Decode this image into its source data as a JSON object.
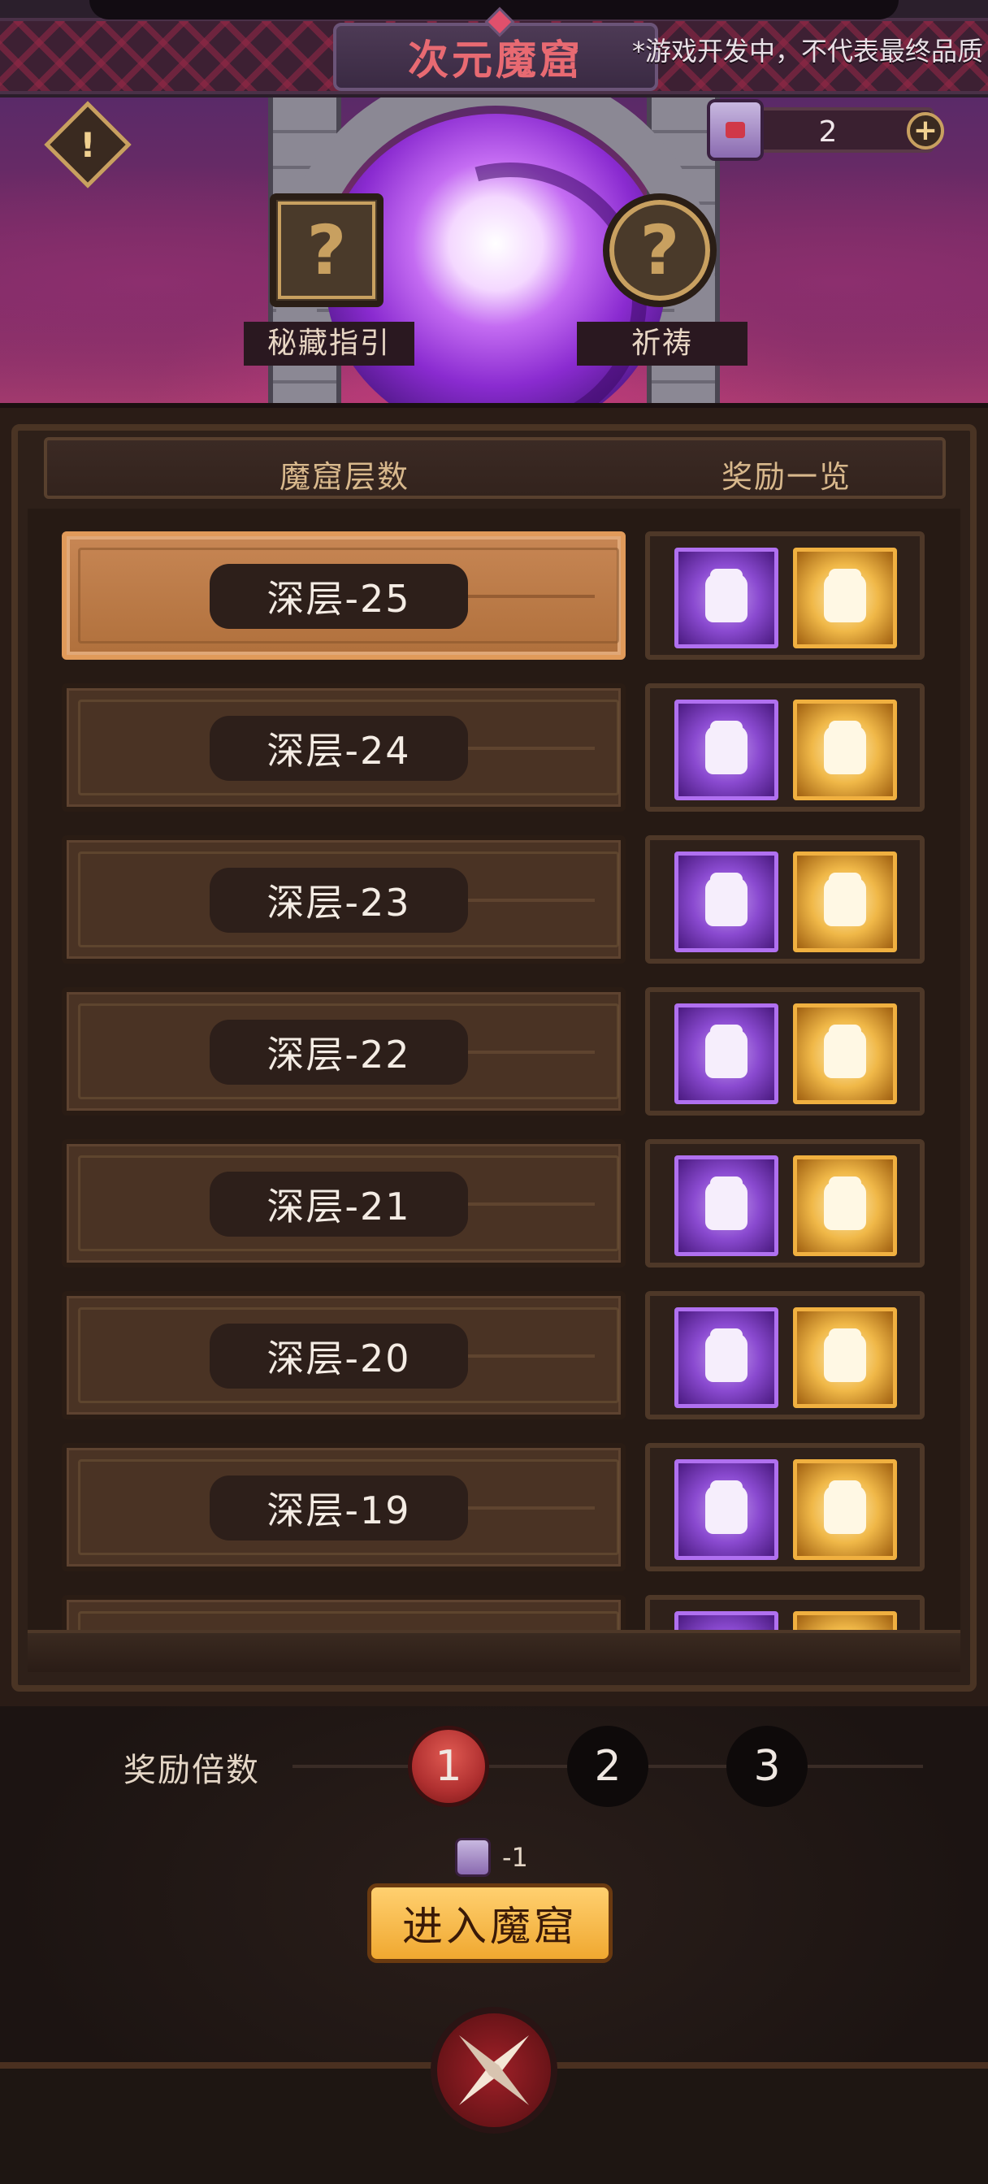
{
  "header": {
    "title": "次元魔窟",
    "dev_note": "*游戏开发中，不代表最终品质"
  },
  "hero": {
    "alert_icon": "!",
    "currency_count": "2",
    "currency_plus": "+",
    "secret_guide_label": "秘藏指引",
    "prayer_label": "祈祷",
    "question_mark": "?"
  },
  "list": {
    "col_layers": "魔窟层数",
    "col_rewards": "奖励一览",
    "rows": [
      {
        "label": "深层-25",
        "selected": true
      },
      {
        "label": "深层-24",
        "selected": false
      },
      {
        "label": "深层-23",
        "selected": false
      },
      {
        "label": "深层-22",
        "selected": false
      },
      {
        "label": "深层-21",
        "selected": false
      },
      {
        "label": "深层-20",
        "selected": false
      },
      {
        "label": "深层-19",
        "selected": false
      }
    ],
    "reward_icons": [
      "purple-armor-icon",
      "gold-armor-icon"
    ]
  },
  "footer": {
    "multiplier_label": "奖励倍数",
    "multipliers": [
      "1",
      "2",
      "3"
    ],
    "selected_multiplier": "1",
    "cost": "-1",
    "enter_button": "进入魔窟"
  },
  "colors": {
    "title": "#e86a72",
    "selected_row": "#c78654",
    "enter_button": "#f0a830",
    "active_multiplier": "#b03030"
  }
}
